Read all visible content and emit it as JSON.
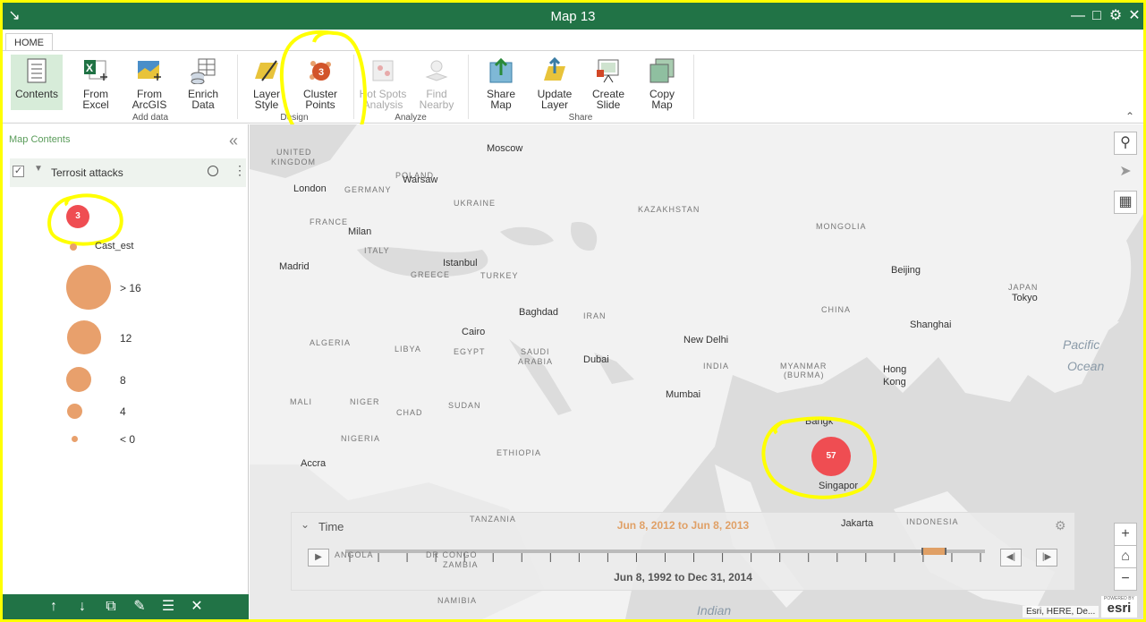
{
  "window": {
    "title": "Map 13"
  },
  "ribbon": {
    "tab": "HOME",
    "buttons": {
      "contents": "Contents",
      "from_excel": [
        "From",
        "Excel"
      ],
      "from_arcgis": [
        "From",
        "ArcGIS"
      ],
      "enrich_data": [
        "Enrich",
        "Data"
      ],
      "layer_style": [
        "Layer",
        "Style"
      ],
      "cluster_points": [
        "Cluster",
        "Points"
      ],
      "cluster_badge": "3",
      "hot_spots": [
        "Hot Spots",
        "Analysis"
      ],
      "find_nearby": [
        "Find",
        "Nearby"
      ],
      "share_map": [
        "Share",
        "Map"
      ],
      "update_layer": [
        "Update",
        "Layer"
      ],
      "create_slide": [
        "Create",
        "Slide"
      ],
      "copy_map": [
        "Copy",
        "Map"
      ]
    },
    "groups": {
      "add_data": "Add data",
      "design": "Design",
      "analyze": "Analyze",
      "share": "Share"
    }
  },
  "panel": {
    "title": "Map Contents",
    "layer_name": "Terrosit attacks",
    "legend_cluster_value": "3",
    "legend_field": "Cast_est",
    "legend": [
      {
        "label": "> 16"
      },
      {
        "label": "12"
      },
      {
        "label": "8"
      },
      {
        "label": "4"
      },
      {
        "label": "< 0"
      }
    ]
  },
  "map": {
    "cities": {
      "moscow": "Moscow",
      "london": "London",
      "warsaw": "Warsaw",
      "milan": "Milan",
      "madrid": "Madrid",
      "istanbul": "Istanbul",
      "baghdad": "Baghdad",
      "cairo": "Cairo",
      "dubai": "Dubai",
      "new_delhi": "New Delhi",
      "mumbai": "Mumbai",
      "beijing": "Beijing",
      "tokyo": "Tokyo",
      "shanghai": "Shanghai",
      "hong_kong_1": "Hong",
      "hong_kong_2": "Kong",
      "singapore": "Singapor",
      "jakarta": "Jakarta",
      "accra": "Accra",
      "bangkok": "Bangk"
    },
    "countries": {
      "uk_1": "UNITED",
      "uk_2": "KINGDOM",
      "poland": "POLAND",
      "germany": "GERMANY",
      "ukraine": "UKRAINE",
      "france": "FRANCE",
      "italy": "ITALY",
      "greece": "GREECE",
      "turkey": "TURKEY",
      "kazakhstan": "KAZAKHSTAN",
      "mongolia": "MONGOLIA",
      "japan": "JAPAN",
      "iran": "IRAN",
      "china": "CHINA",
      "algeria": "ALGERIA",
      "libya": "LIBYA",
      "egypt": "EGYPT",
      "saudi_1": "SAUDI",
      "saudi_2": "ARABIA",
      "india": "INDIA",
      "myanmar_1": "MYANMAR",
      "myanmar_2": "(BURMA)",
      "mali": "MALI",
      "niger": "NIGER",
      "chad": "CHAD",
      "sudan": "SUDAN",
      "nigeria": "NIGERIA",
      "ethiopia": "ETHIOPIA",
      "dr_congo": "DR CONGO",
      "tanzania": "TANZANIA",
      "angola": "ANGOLA",
      "zambia": "ZAMBIA",
      "namibia": "NAMIBIA",
      "indonesia": "INDONESIA"
    },
    "oceans": {
      "pacific_1": "Pacific",
      "pacific_2": "Ocean",
      "indian": "Indian"
    },
    "cluster_value": "57",
    "attribution": "Esri, HERE, De...",
    "esri_powered": "POWERED BY",
    "esri_logo": "esri"
  },
  "time": {
    "label": "Time",
    "selected_range": "Jun 8, 2012 to Jun 8, 2013",
    "full_range": "Jun 8, 1992 to Dec 31, 2014",
    "selection_start_fraction": 0.7,
    "selection_end_fraction": 0.8
  },
  "colors": {
    "brand": "#217346",
    "highlight": "#ffff00",
    "cluster": "#ef4d52",
    "legend": "#e8a06c"
  }
}
